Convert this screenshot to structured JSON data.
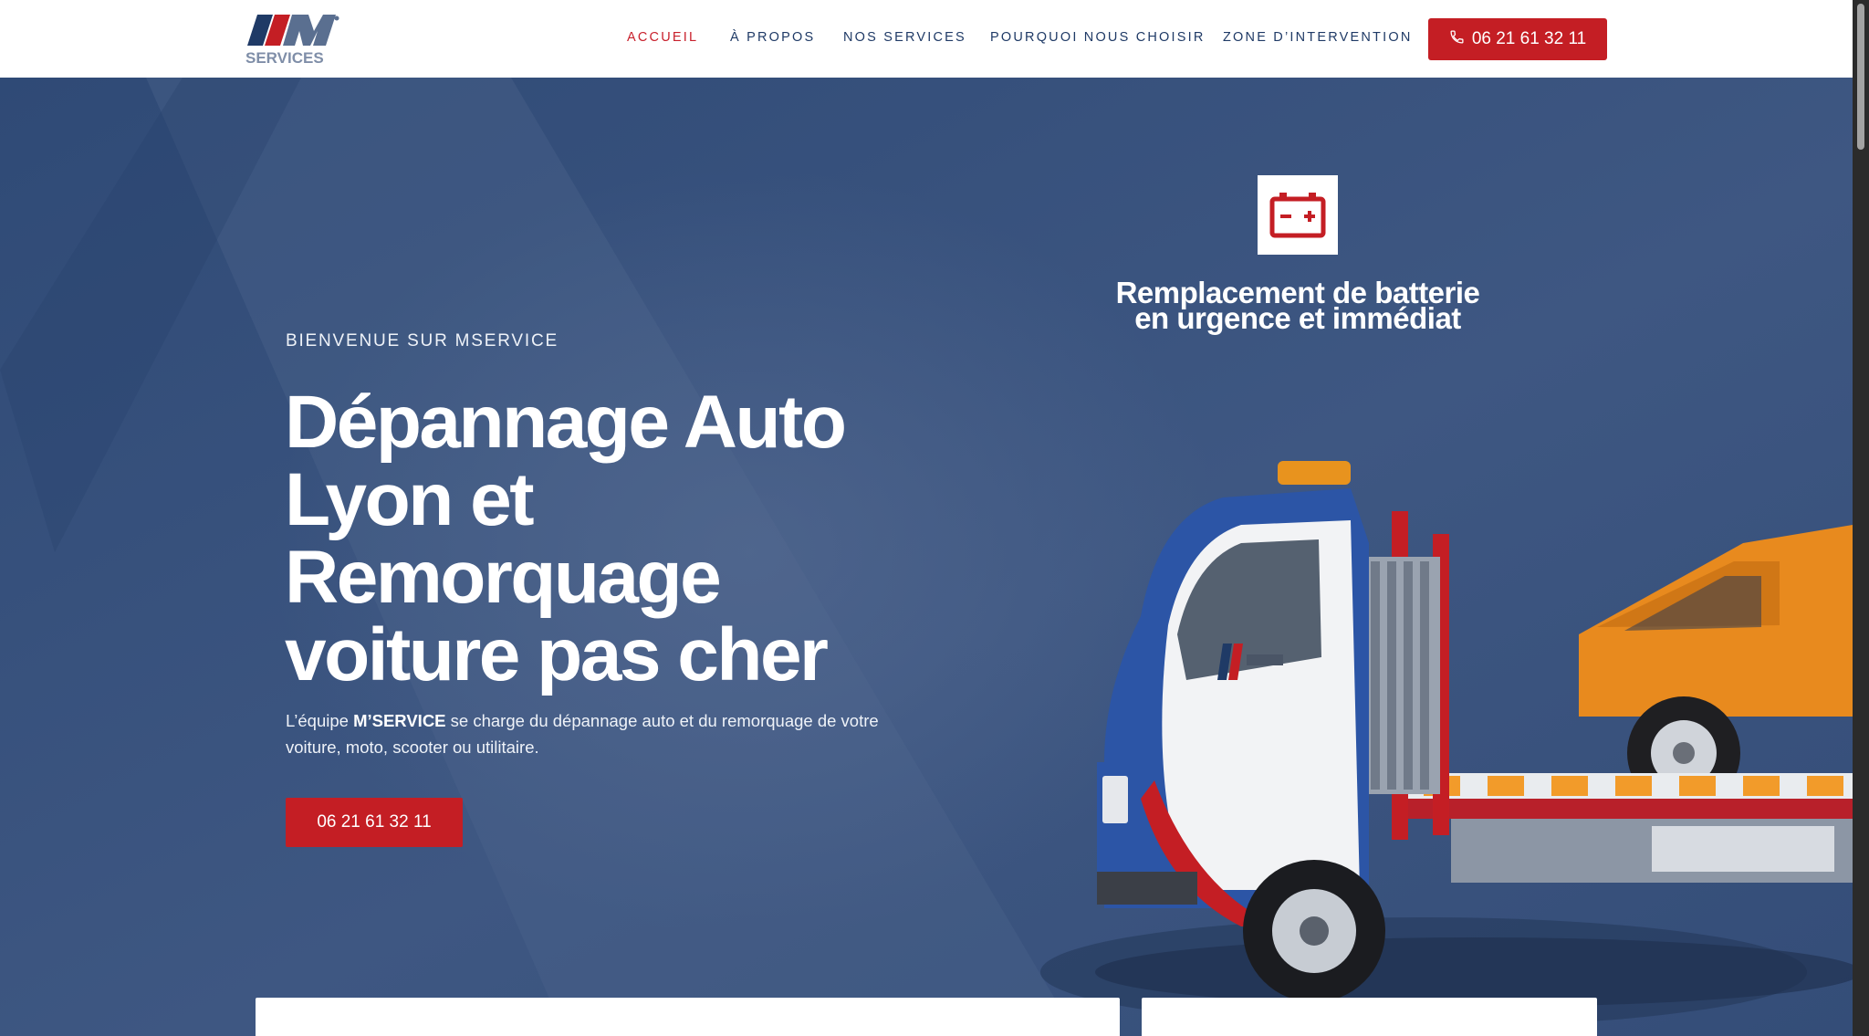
{
  "brand": {
    "logo_text": "SERVICES",
    "colors": {
      "blue": "#1f3a66",
      "red": "#c41e24",
      "hero_blue": "#3d5680"
    }
  },
  "nav": {
    "items": [
      {
        "label": "ACCUEIL",
        "active": true
      },
      {
        "label": "À PROPOS",
        "active": false
      },
      {
        "label": "NOS SERVICES",
        "active": false
      },
      {
        "label": "POURQUOI NOUS CHOISIR",
        "active": false
      },
      {
        "label": "ZONE D’INTERVENTION",
        "active": false
      }
    ],
    "call_button": {
      "label": "06 21 61 32 11",
      "icon": "phone-icon"
    }
  },
  "hero": {
    "eyebrow": "BIENVENUE SUR MSERVICE",
    "headline_lines": [
      "Dépannage Auto",
      "Lyon et",
      "Remorquage",
      "voiture pas cher"
    ],
    "intro": {
      "prefix": "L’équipe ",
      "brand": "M’SERVICE",
      "suffix": " se charge du dépannage auto et du remorquage de votre voiture, moto, scooter ou utilitaire."
    },
    "cta_label": "06 21 61 32 11"
  },
  "feature": {
    "icon": "car-battery-icon",
    "title_lines": [
      "Remplacement de batterie",
      "en urgence et immédiat"
    ]
  }
}
